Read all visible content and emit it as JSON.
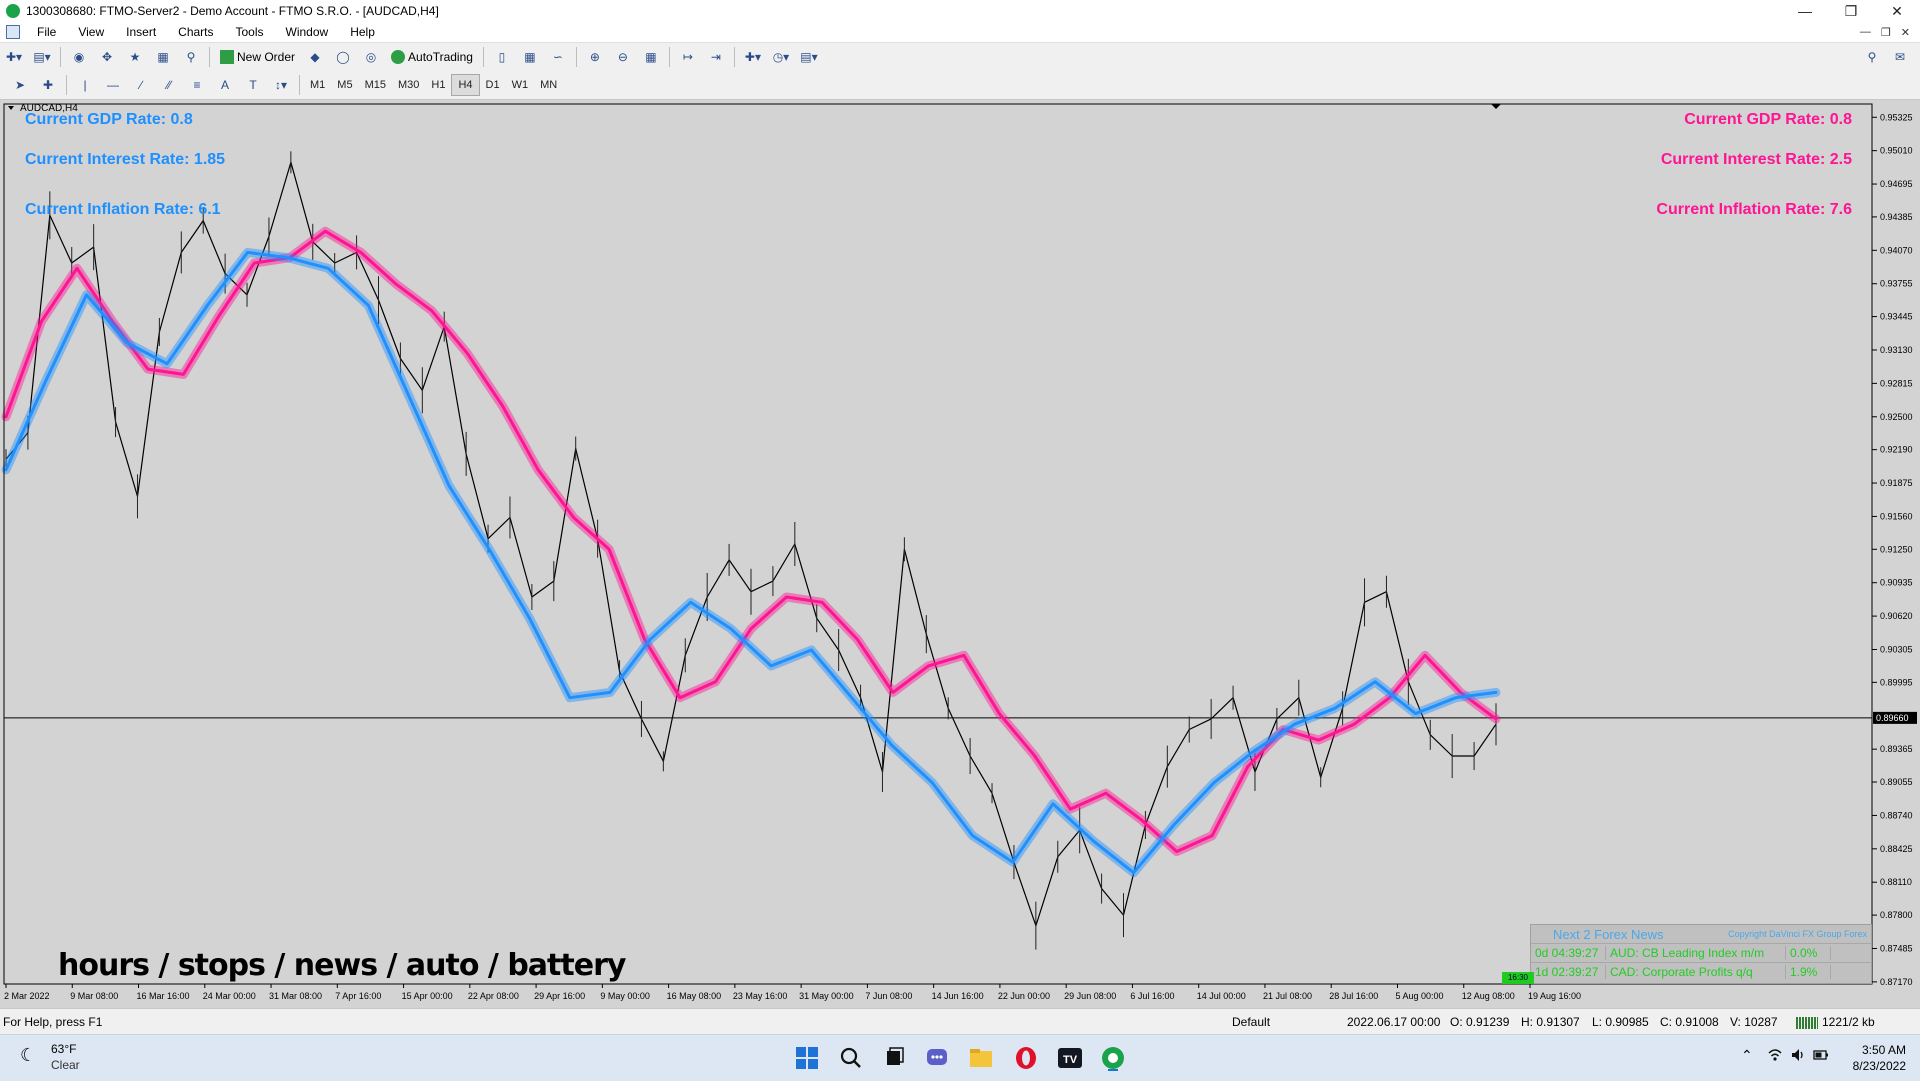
{
  "window": {
    "title": "1300308680: FTMO-Server2 - Demo Account - FTMO S.R.O. - [AUDCAD,H4]"
  },
  "menu": [
    "File",
    "View",
    "Insert",
    "Charts",
    "Tools",
    "Window",
    "Help"
  ],
  "toolbar": {
    "new_order": "New Order",
    "auto_trading": "AutoTrading",
    "timeframes": [
      "M1",
      "M5",
      "M15",
      "M30",
      "H1",
      "H4",
      "D1",
      "W1",
      "MN"
    ],
    "active_timeframe": "H4"
  },
  "chart": {
    "symbol_label": "AUDCAD,H4",
    "left_stats": {
      "gdp": "Current GDP Rate: 0.8",
      "interest": "Current Interest Rate: 1.85",
      "inflation": "Current Inflation Rate: 6.1"
    },
    "right_stats": {
      "gdp": "Current GDP Rate: 0.8",
      "interest": "Current Interest Rate: 2.5",
      "inflation": "Current Inflation Rate: 7.6"
    },
    "bottom_text": "hours / stops / news / auto / battery",
    "news_panel": {
      "title": "Next 2 Forex News",
      "copyright": "Copyright DaVinci FX Group Forex",
      "rows": [
        {
          "time": "0d 04:39:27",
          "event": "AUD: CB Leading Index m/m",
          "value": "0.0%"
        },
        {
          "time": "1d 02:39:27",
          "event": "CAD: Corporate Profits q/q",
          "value": "1.9%"
        }
      ],
      "badge": "16:30"
    }
  },
  "chart_data": {
    "type": "line",
    "symbol": "AUDCAD",
    "timeframe": "H4",
    "ylim": [
      0.8715,
      0.9545
    ],
    "y_ticks": [
      0.95325,
      0.9501,
      0.94695,
      0.94385,
      0.9407,
      0.93755,
      0.93445,
      0.9313,
      0.92815,
      0.925,
      0.9219,
      0.91875,
      0.9156,
      0.9125,
      0.90935,
      0.9062,
      0.90305,
      0.89995,
      0.89365,
      0.89055,
      0.8874,
      0.88425,
      0.8811,
      0.878,
      0.87485,
      0.8717
    ],
    "current_price": 0.8966,
    "x_ticks": [
      "2 Mar 2022",
      "9 Mar 08:00",
      "16 Mar 16:00",
      "24 Mar 00:00",
      "31 Mar 08:00",
      "7 Apr 16:00",
      "15 Apr 00:00",
      "22 Apr 08:00",
      "29 Apr 16:00",
      "9 May 00:00",
      "16 May 08:00",
      "23 May 16:00",
      "31 May 00:00",
      "7 Jun 08:00",
      "14 Jun 16:00",
      "22 Jun 00:00",
      "29 Jun 08:00",
      "6 Jul 16:00",
      "14 Jul 00:00",
      "21 Jul 08:00",
      "28 Jul 16:00",
      "5 Aug 00:00",
      "12 Aug 08:00",
      "19 Aug 16:00"
    ],
    "series": [
      {
        "color": "#000000",
        "values": [
          0.921,
          0.9235,
          0.944,
          0.9395,
          0.941,
          0.9245,
          0.9175,
          0.933,
          0.9405,
          0.9435,
          0.9385,
          0.9365,
          0.942,
          0.949,
          0.9415,
          0.9395,
          0.9405,
          0.936,
          0.9305,
          0.9275,
          0.9335,
          0.9215,
          0.9135,
          0.9155,
          0.908,
          0.9095,
          0.922,
          0.9135,
          0.901,
          0.8965,
          0.8925,
          0.9025,
          0.908,
          0.9115,
          0.9085,
          0.9095,
          0.913,
          0.906,
          0.903,
          0.8985,
          0.8915,
          0.9125,
          0.9045,
          0.8975,
          0.893,
          0.8895,
          0.883,
          0.877,
          0.8835,
          0.886,
          0.8805,
          0.878,
          0.8865,
          0.892,
          0.8955,
          0.8965,
          0.8985,
          0.8915,
          0.8965,
          0.8985,
          0.891,
          0.8975,
          0.9075,
          0.9085,
          0.9,
          0.895,
          0.893,
          0.893,
          0.896
        ]
      },
      {
        "color": "#ff1493",
        "values": [
          0.925,
          0.934,
          0.939,
          0.934,
          0.9295,
          0.929,
          0.9345,
          0.9395,
          0.94,
          0.9425,
          0.9405,
          0.9375,
          0.935,
          0.931,
          0.926,
          0.92,
          0.9155,
          0.9125,
          0.904,
          0.8985,
          0.9,
          0.905,
          0.908,
          0.9075,
          0.904,
          0.899,
          0.9015,
          0.9025,
          0.897,
          0.893,
          0.888,
          0.8895,
          0.887,
          0.884,
          0.8855,
          0.892,
          0.8955,
          0.8945,
          0.896,
          0.8985,
          0.9025,
          0.899,
          0.8965
        ]
      },
      {
        "color": "#1e90ff",
        "values": [
          0.92,
          0.9285,
          0.9365,
          0.932,
          0.93,
          0.9355,
          0.9405,
          0.94,
          0.939,
          0.9355,
          0.927,
          0.9185,
          0.9125,
          0.906,
          0.8985,
          0.899,
          0.904,
          0.9075,
          0.905,
          0.9015,
          0.903,
          0.8985,
          0.894,
          0.8905,
          0.8855,
          0.883,
          0.8885,
          0.885,
          0.882,
          0.8865,
          0.8905,
          0.8935,
          0.896,
          0.8975,
          0.9,
          0.897,
          0.8985,
          0.899
        ]
      }
    ]
  },
  "status": {
    "help": "For Help, press F1",
    "profile": "Default",
    "datetime": "2022.06.17 00:00",
    "open": "O: 0.91239",
    "high": "H: 0.91307",
    "low": "L: 0.90985",
    "close": "C: 0.91008",
    "volume": "V: 10287",
    "traffic": "1221/2 kb"
  },
  "taskbar": {
    "temperature": "63°F",
    "condition": "Clear",
    "time": "3:50 AM",
    "date": "8/23/2022"
  },
  "colors": {
    "chart_bg": "#d3d3d3",
    "blue": "#1e90ff",
    "pink": "#ff1493"
  }
}
